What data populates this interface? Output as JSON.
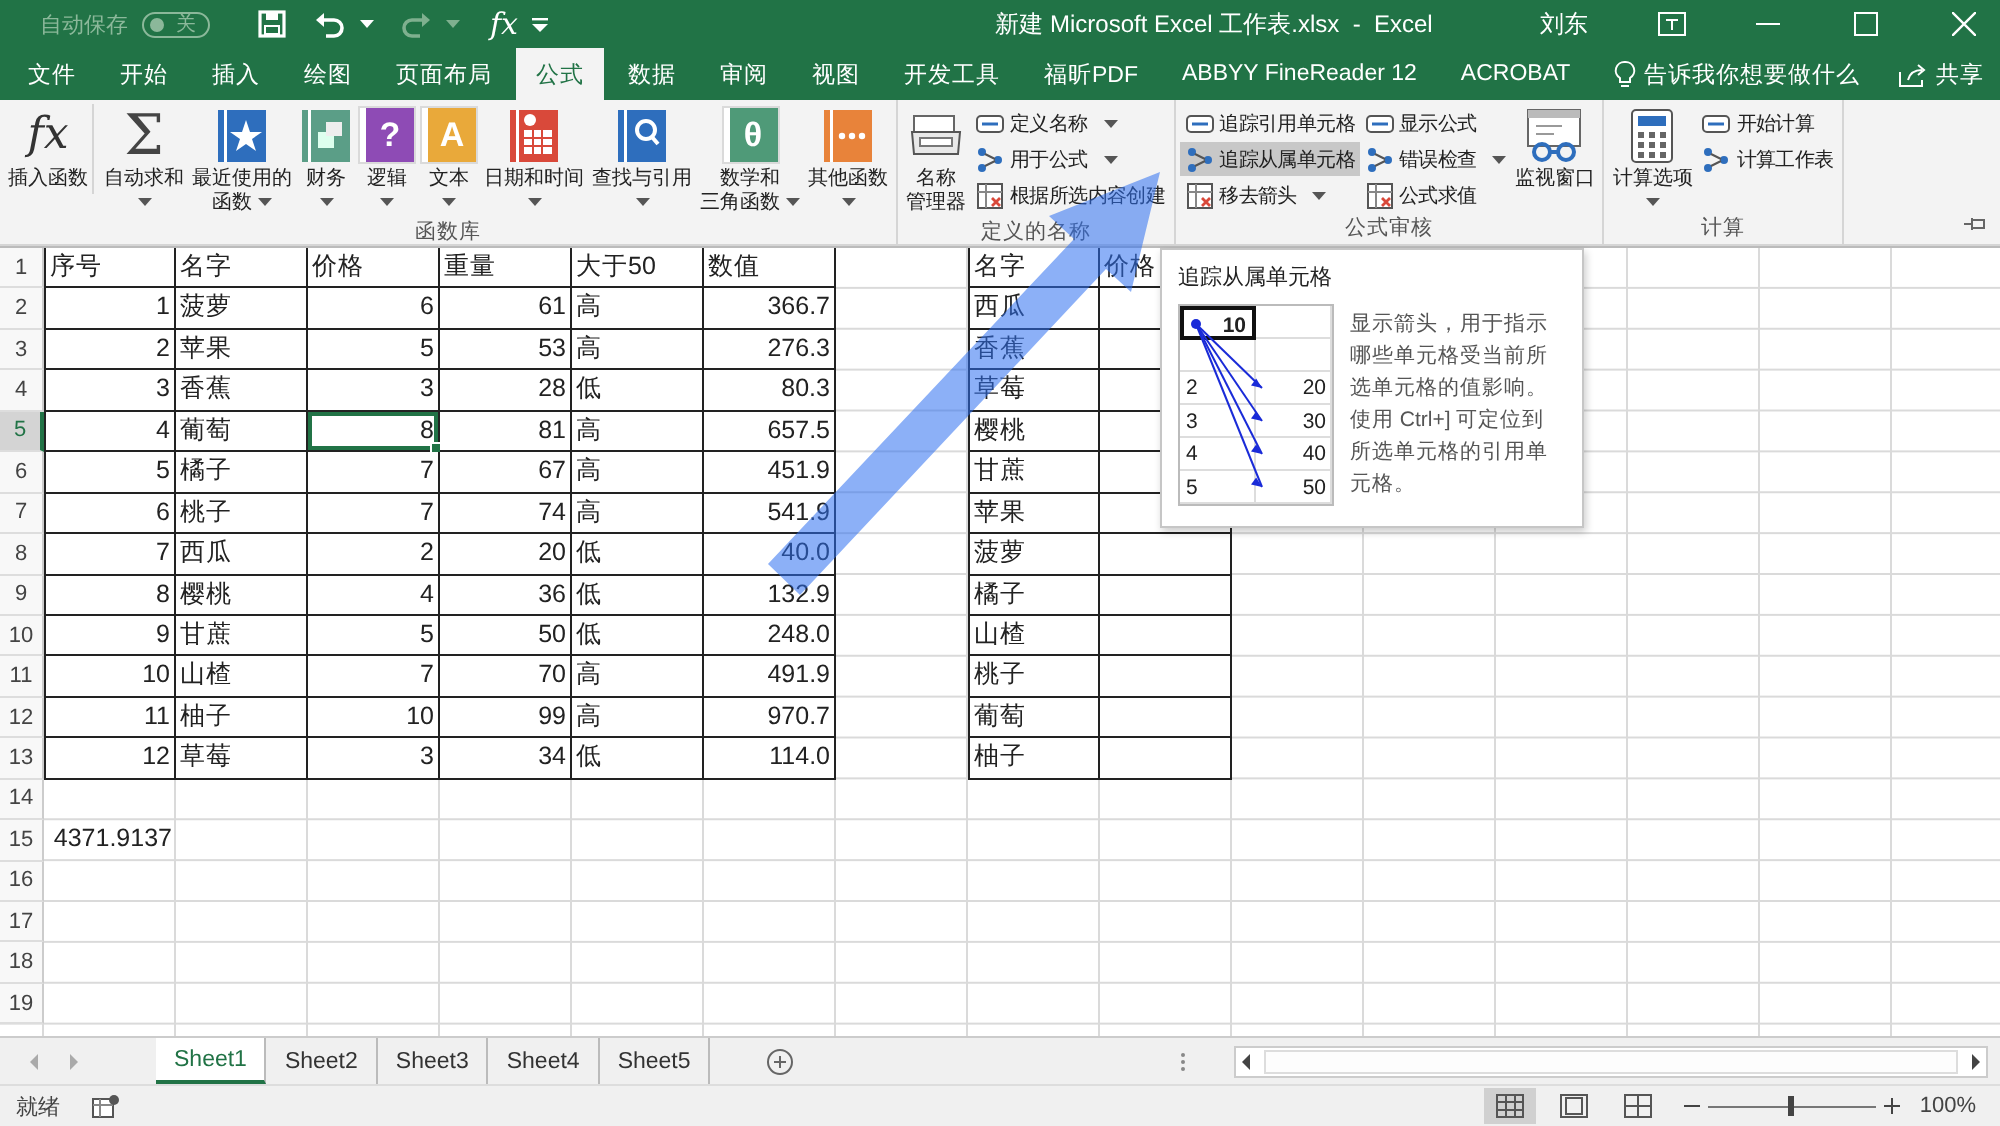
{
  "title_bar": {
    "autosave_label": "自动保存",
    "autosave_toggle": {
      "label": "关",
      "on": false
    },
    "quick_glyph": "fx",
    "title": "新建 Microsoft Excel 工作表.xlsx  -  Excel",
    "user": "刘东"
  },
  "tabs": [
    {
      "label": "文件",
      "selected": false
    },
    {
      "label": "开始",
      "selected": false
    },
    {
      "label": "插入",
      "selected": false
    },
    {
      "label": "绘图",
      "selected": false
    },
    {
      "label": "页面布局",
      "selected": false
    },
    {
      "label": "公式",
      "selected": true
    },
    {
      "label": "数据",
      "selected": false
    },
    {
      "label": "审阅",
      "selected": false
    },
    {
      "label": "视图",
      "selected": false
    },
    {
      "label": "开发工具",
      "selected": false
    },
    {
      "label": "福昕PDF",
      "selected": false
    },
    {
      "label": "ABBYY FineReader 12",
      "selected": false
    },
    {
      "label": "ACROBAT",
      "selected": false
    }
  ],
  "tell_me": "告诉我你想要做什么",
  "share": "共享",
  "ribbon": [
    {
      "label": "函数库",
      "items": [
        {
          "kind": "large",
          "lines": [
            "插入函数"
          ],
          "dropdown": false,
          "glyph": "fx"
        },
        {
          "kind": "large",
          "lines": [
            "自动求和"
          ],
          "dropdown": true,
          "glyph": "Σ"
        },
        {
          "kind": "large",
          "lines": [
            "最近使用的",
            "函数"
          ],
          "dropdown": true
        },
        {
          "kind": "large",
          "lines": [
            "财务"
          ],
          "dropdown": true
        },
        {
          "kind": "large",
          "lines": [
            "逻辑"
          ],
          "dropdown": true,
          "glyph": "?"
        },
        {
          "kind": "large",
          "lines": [
            "文本"
          ],
          "dropdown": true,
          "glyph": "A"
        },
        {
          "kind": "large",
          "lines": [
            "日期和时间"
          ],
          "dropdown": true
        },
        {
          "kind": "large",
          "lines": [
            "查找与引用"
          ],
          "dropdown": true
        },
        {
          "kind": "large",
          "lines": [
            "数学和",
            "三角函数"
          ],
          "dropdown": true,
          "glyph": "θ"
        },
        {
          "kind": "large",
          "lines": [
            "其他函数"
          ],
          "dropdown": true
        }
      ]
    },
    {
      "label": "定义的名称",
      "items": [
        {
          "kind": "large",
          "lines": [
            "名称",
            "管理器"
          ],
          "dropdown": false
        },
        {
          "kind": "stack",
          "buttons": [
            {
              "label": "定义名称",
              "dropdown": true,
              "highlighted": false
            },
            {
              "label": "用于公式",
              "dropdown": true,
              "highlighted": false
            },
            {
              "label": "根据所选内容创建",
              "dropdown": false,
              "highlighted": false
            }
          ]
        }
      ]
    },
    {
      "label": "公式审核",
      "items": [
        {
          "kind": "stack",
          "buttons": [
            {
              "label": "追踪引用单元格",
              "dropdown": false,
              "highlighted": false
            },
            {
              "label": "追踪从属单元格",
              "dropdown": false,
              "highlighted": true
            },
            {
              "label": "移去箭头",
              "dropdown": true,
              "highlighted": false
            }
          ]
        },
        {
          "kind": "stack",
          "buttons": [
            {
              "label": "显示公式",
              "dropdown": false,
              "highlighted": false
            },
            {
              "label": "错误检查",
              "dropdown": true,
              "highlighted": false
            },
            {
              "label": "公式求值",
              "dropdown": false,
              "highlighted": false
            }
          ]
        },
        {
          "kind": "large",
          "lines": [
            "监视窗口"
          ],
          "dropdown": false
        }
      ]
    },
    {
      "label": "计算",
      "items": [
        {
          "kind": "large",
          "lines": [
            "计算选项"
          ],
          "dropdown": true
        },
        {
          "kind": "stack",
          "buttons": [
            {
              "label": "开始计算",
              "dropdown": false,
              "highlighted": false
            },
            {
              "label": "计算工作表",
              "dropdown": false,
              "highlighted": false
            }
          ]
        }
      ]
    }
  ],
  "sheet": {
    "row_numbers": [
      "1",
      "2",
      "3",
      "4",
      "5",
      "6",
      "7",
      "8",
      "9",
      "10",
      "11",
      "12",
      "13",
      "14",
      "15",
      "16",
      "17",
      "18",
      "19"
    ],
    "table_1": [
      [
        {
          "text": "序号",
          "selected": false
        },
        {
          "text": "名字",
          "selected": false
        },
        {
          "text": "价格",
          "selected": false
        },
        {
          "text": "重量",
          "selected": false
        },
        {
          "text": "大于50",
          "selected": false
        },
        {
          "text": "数值",
          "selected": false
        }
      ],
      [
        {
          "text": "1",
          "selected": false
        },
        {
          "text": "菠萝",
          "selected": false
        },
        {
          "text": "6",
          "selected": false
        },
        {
          "text": "61",
          "selected": false
        },
        {
          "text": "高",
          "selected": false
        },
        {
          "text": "366.7",
          "selected": false
        }
      ],
      [
        {
          "text": "2",
          "selected": false
        },
        {
          "text": "苹果",
          "selected": false
        },
        {
          "text": "5",
          "selected": false
        },
        {
          "text": "53",
          "selected": false
        },
        {
          "text": "高",
          "selected": false
        },
        {
          "text": "276.3",
          "selected": false
        }
      ],
      [
        {
          "text": "3",
          "selected": false
        },
        {
          "text": "香蕉",
          "selected": false
        },
        {
          "text": "3",
          "selected": false
        },
        {
          "text": "28",
          "selected": false
        },
        {
          "text": "低",
          "selected": false
        },
        {
          "text": "80.3",
          "selected": false
        }
      ],
      [
        {
          "text": "4",
          "selected": false
        },
        {
          "text": "葡萄",
          "selected": false
        },
        {
          "text": "8",
          "selected": true
        },
        {
          "text": "81",
          "selected": false
        },
        {
          "text": "高",
          "selected": false
        },
        {
          "text": "657.5",
          "selected": false
        }
      ],
      [
        {
          "text": "5",
          "selected": false
        },
        {
          "text": "橘子",
          "selected": false
        },
        {
          "text": "7",
          "selected": false
        },
        {
          "text": "67",
          "selected": false
        },
        {
          "text": "高",
          "selected": false
        },
        {
          "text": "451.9",
          "selected": false
        }
      ],
      [
        {
          "text": "6",
          "selected": false
        },
        {
          "text": "桃子",
          "selected": false
        },
        {
          "text": "7",
          "selected": false
        },
        {
          "text": "74",
          "selected": false
        },
        {
          "text": "高",
          "selected": false
        },
        {
          "text": "541.9",
          "selected": false
        }
      ],
      [
        {
          "text": "7",
          "selected": false
        },
        {
          "text": "西瓜",
          "selected": false
        },
        {
          "text": "2",
          "selected": false
        },
        {
          "text": "20",
          "selected": false
        },
        {
          "text": "低",
          "selected": false
        },
        {
          "text": "40.0",
          "selected": false
        }
      ],
      [
        {
          "text": "8",
          "selected": false
        },
        {
          "text": "樱桃",
          "selected": false
        },
        {
          "text": "4",
          "selected": false
        },
        {
          "text": "36",
          "selected": false
        },
        {
          "text": "低",
          "selected": false
        },
        {
          "text": "132.9",
          "selected": false
        }
      ],
      [
        {
          "text": "9",
          "selected": false
        },
        {
          "text": "甘蔗",
          "selected": false
        },
        {
          "text": "5",
          "selected": false
        },
        {
          "text": "50",
          "selected": false
        },
        {
          "text": "低",
          "selected": false
        },
        {
          "text": "248.0",
          "selected": false
        }
      ],
      [
        {
          "text": "10",
          "selected": false
        },
        {
          "text": "山楂",
          "selected": false
        },
        {
          "text": "7",
          "selected": false
        },
        {
          "text": "70",
          "selected": false
        },
        {
          "text": "高",
          "selected": false
        },
        {
          "text": "491.9",
          "selected": false
        }
      ],
      [
        {
          "text": "11",
          "selected": false
        },
        {
          "text": "柚子",
          "selected": false
        },
        {
          "text": "10",
          "selected": false
        },
        {
          "text": "99",
          "selected": false
        },
        {
          "text": "高",
          "selected": false
        },
        {
          "text": "970.7",
          "selected": false
        }
      ],
      [
        {
          "text": "12",
          "selected": false
        },
        {
          "text": "草莓",
          "selected": false
        },
        {
          "text": "3",
          "selected": false
        },
        {
          "text": "34",
          "selected": false
        },
        {
          "text": "低",
          "selected": false
        },
        {
          "text": "114.0",
          "selected": false
        }
      ]
    ],
    "table_2": [
      [
        "名字",
        "价格"
      ],
      [
        "西瓜"
      ],
      [
        "香蕉"
      ],
      [
        "草莓"
      ],
      [
        "樱桃"
      ],
      [
        "甘蔗"
      ],
      [
        "苹果"
      ],
      [
        "菠萝"
      ],
      [
        "橘子"
      ],
      [
        "山楂"
      ],
      [
        "桃子"
      ],
      [
        "葡萄"
      ],
      [
        "柚子"
      ]
    ],
    "total": "4371.9137"
  },
  "tooltip": {
    "title": "追踪从属单元格",
    "example": {
      "source": "10",
      "rows": [
        [
          "2",
          "20"
        ],
        [
          "3",
          "30"
        ],
        [
          "4",
          "40"
        ],
        [
          "5",
          "50"
        ]
      ]
    },
    "description": "显示箭头，用于指示哪些单元格受当前所选单元格的值影响。使用 Ctrl+] 可定位到所选单元格的引用单元格。"
  },
  "sheet_tabs": [
    {
      "label": "Sheet1",
      "selected": true
    },
    {
      "label": "Sheet2",
      "selected": false
    },
    {
      "label": "Sheet3",
      "selected": false
    },
    {
      "label": "Sheet4",
      "selected": false
    },
    {
      "label": "Sheet5",
      "selected": false
    }
  ],
  "status_bar": {
    "status": "就绪",
    "views": [
      {
        "selected": true
      },
      {
        "selected": false
      },
      {
        "selected": false
      }
    ],
    "zoom": {
      "level": 0.5,
      "reading": "100%"
    }
  }
}
